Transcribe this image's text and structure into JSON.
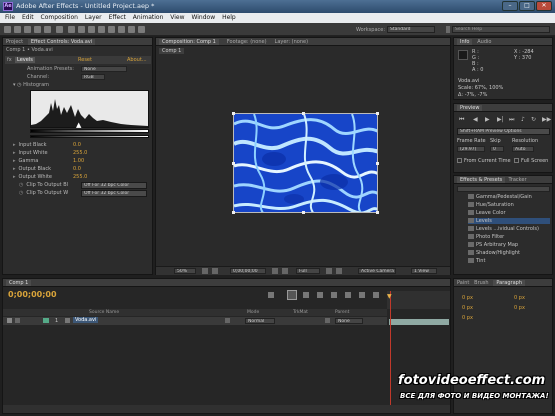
{
  "window": {
    "title": "Adobe After Effects - Untitled Project.aep *",
    "logo": "Ae"
  },
  "menu": [
    "File",
    "Edit",
    "Composition",
    "Layer",
    "Effect",
    "Animation",
    "View",
    "Window",
    "Help"
  ],
  "toolbar": {
    "workspace_label": "Workspace:",
    "workspace_value": "Standard",
    "search_placeholder": "Search Help"
  },
  "project_panel": {
    "tab": "Project",
    "effect_tab": "Effect Controls: Voda.avi",
    "breadcrumb": "Comp 1 • Voda.avi"
  },
  "levels": {
    "effect_name": "Levels",
    "reset": "Reset",
    "about": "About...",
    "animation_presets_label": "Animation Presets:",
    "animation_presets_value": "None",
    "channel_label": "Channel:",
    "channel_value": "RGB",
    "histogram_label": "Histogram",
    "params": [
      {
        "label": "Input Black",
        "value": "0.0"
      },
      {
        "label": "Input White",
        "value": "255.0"
      },
      {
        "label": "Gamma",
        "value": "1.00"
      },
      {
        "label": "Output Black",
        "value": "0.0"
      },
      {
        "label": "Output White",
        "value": "255.0"
      }
    ],
    "clip_rows": [
      {
        "label": "Clip To Output Bl",
        "value": "Off For 32 bpc Color"
      },
      {
        "label": "Clip To Output W",
        "value": "Off For 32 bpc Color"
      }
    ]
  },
  "composition_panel": {
    "tab": "Composition: Comp 1",
    "tab2": "Footage: (none)",
    "tab3": "Layer: (none)",
    "crumb": "Comp 1",
    "zoom": "50%",
    "timecode": "0;00;00;00",
    "resolution": "Full",
    "camera": "Active Camera",
    "views": "1 View"
  },
  "info_panel": {
    "tab": "Info",
    "tab2": "Audio",
    "r": "R :",
    "g": "G :",
    "b": "B :",
    "a": "A : 0",
    "x": "X : -284",
    "y": "Y : 370",
    "file": "Voda.avi",
    "scale": "Scale: 67%, 100%",
    "delta": "Δ: -7%, -7%"
  },
  "preview_panel": {
    "tab": "Preview",
    "ram": "Shift+RAM Preview Options",
    "frame_rate_label": "Frame Rate",
    "skip_label": "Skip",
    "resolution_label": "Resolution",
    "frame_rate": "(29.97)",
    "skip": "0",
    "res": "Auto",
    "from_current": "From Current Time",
    "full_screen": "Full Screen"
  },
  "effects_panel": {
    "tab": "Effects & Presets",
    "tab2": "Tracker",
    "items": [
      "Gamma/Pedestal/Gain",
      "Hue/Saturation",
      "Leave Color",
      "Levels",
      "Levels ...ividual Controls)",
      "Photo Filter",
      "PS Arbitrary Map",
      "Shadow/Highlight",
      "Tint"
    ]
  },
  "timeline": {
    "tab": "Comp 1",
    "timecode": "0;00;00;00",
    "col_source": "Source Name",
    "col_mode": "Mode",
    "col_trkmat": "TrkMat",
    "col_parent": "Parent",
    "layer": {
      "index": "1",
      "name": "Voda.avi",
      "mode": "Normal",
      "parent": "None"
    }
  },
  "paragraph_panel": {
    "tab": "Paint",
    "tab2": "Brush",
    "tab3": "Paragraph",
    "values": [
      "0 px",
      "0 px",
      "0 px",
      "0 px",
      "0 px"
    ]
  },
  "watermark": {
    "line1": "fotovideoeffect.com",
    "line2": "ВСЕ ДЛЯ ФОТО И ВИДЕО МОНТАЖА!"
  },
  "colors": {
    "accent": "#d9a43a",
    "titlebar": "#3c5d80",
    "playhead": "#c0392b"
  }
}
